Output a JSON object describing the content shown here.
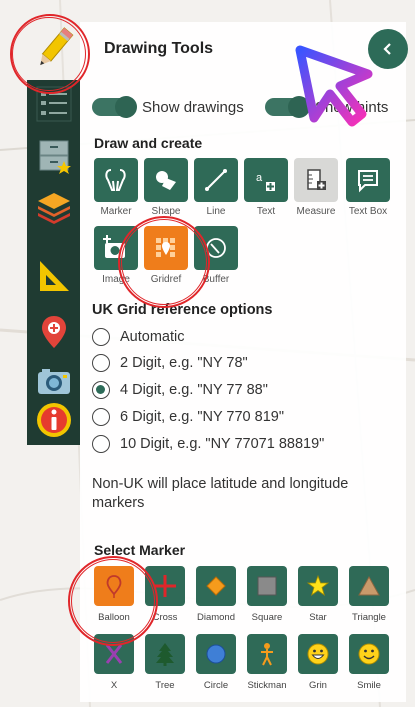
{
  "panel": {
    "title": "Drawing Tools",
    "collapse_icon": "chevron-left-icon"
  },
  "toggles": [
    {
      "label": "Show drawings",
      "on": true
    },
    {
      "label": "Show hints",
      "on": true
    }
  ],
  "sidebar": {
    "items": [
      {
        "name": "drawing-tools-tab",
        "icon": "pencil-icon"
      },
      {
        "name": "layer-list-tab",
        "icon": "list-icon"
      },
      {
        "name": "favourites-tab",
        "icon": "drawer-star-icon"
      },
      {
        "name": "layers-tab",
        "icon": "layers-icon"
      },
      {
        "name": "measure-tab",
        "icon": "set-square-icon"
      },
      {
        "name": "location-tab",
        "icon": "location-pin-icon"
      },
      {
        "name": "camera-tab",
        "icon": "camera-icon"
      },
      {
        "name": "info-tab",
        "icon": "info-icon"
      }
    ]
  },
  "draw_create": {
    "heading": "Draw and create",
    "tools": [
      {
        "label": "Marker",
        "icon": "marker-icon"
      },
      {
        "label": "Shape",
        "icon": "shape-icon"
      },
      {
        "label": "Line",
        "icon": "line-icon"
      },
      {
        "label": "Text",
        "icon": "text-icon"
      },
      {
        "label": "Measure",
        "icon": "measure-icon"
      },
      {
        "label": "Text Box",
        "icon": "text-box-icon"
      },
      {
        "label": "Image",
        "icon": "add-image-icon"
      },
      {
        "label": "Gridref",
        "icon": "gridref-icon"
      },
      {
        "label": "Buffer",
        "icon": "buffer-icon"
      }
    ]
  },
  "grid_options": {
    "heading": "UK Grid reference options",
    "options": [
      {
        "label": "Automatic",
        "checked": false
      },
      {
        "label": "2 Digit, e.g. \"NY 78\"",
        "checked": false
      },
      {
        "label": "4 Digit, e.g. \"NY 77 88\"",
        "checked": true
      },
      {
        "label": "6 Digit, e.g. \"NY 770 819\"",
        "checked": false
      },
      {
        "label": "10 Digit, e.g. \"NY 77071 88819\"",
        "checked": false
      }
    ],
    "note": "Non-UK will place latitude and longitude markers"
  },
  "markers": {
    "heading": "Select Marker",
    "items": [
      {
        "label": "Balloon",
        "icon": "balloon-icon"
      },
      {
        "label": "Cross",
        "icon": "cross-icon"
      },
      {
        "label": "Diamond",
        "icon": "diamond-icon"
      },
      {
        "label": "Square",
        "icon": "square-icon"
      },
      {
        "label": "Star",
        "icon": "star-icon"
      },
      {
        "label": "Triangle",
        "icon": "triangle-icon"
      },
      {
        "label": "X",
        "icon": "x-icon"
      },
      {
        "label": "Tree",
        "icon": "tree-icon"
      },
      {
        "label": "Circle",
        "icon": "circle-icon"
      },
      {
        "label": "Stickman",
        "icon": "stickman-icon"
      },
      {
        "label": "Grin",
        "icon": "grin-icon"
      },
      {
        "label": "Smile",
        "icon": "smile-icon"
      }
    ]
  },
  "colors": {
    "tool_green": "#2f6a57",
    "active_orange": "#ef7d1b",
    "sidebar_dark": "#1f3b32",
    "highlight_red": "#e0262a"
  }
}
